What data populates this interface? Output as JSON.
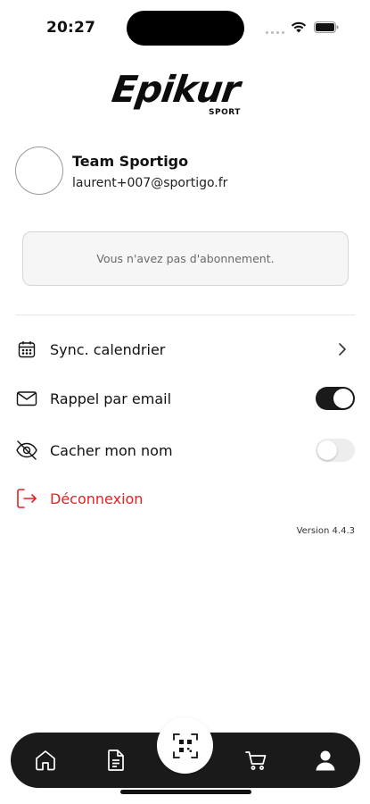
{
  "status_bar": {
    "time": "20:27"
  },
  "brand": {
    "logo_text": "Epikur",
    "logo_sub": "SPORT"
  },
  "profile": {
    "name": "Team Sportigo",
    "email": "laurent+007@sportigo.fr"
  },
  "subscription": {
    "message": "Vous n'avez pas d'abonnement."
  },
  "settings": {
    "calendar_sync": {
      "label": "Sync. calendrier",
      "icon": "calendar-icon"
    },
    "email_reminder": {
      "label": "Rappel par email",
      "icon": "mail-icon",
      "enabled": true
    },
    "hide_name": {
      "label": "Cacher mon nom",
      "icon": "eye-off-icon",
      "enabled": false
    },
    "logout": {
      "label": "Déconnexion",
      "icon": "logout-icon",
      "color": "#e02424"
    }
  },
  "version": "Version 4.4.3",
  "tabbar": {
    "items": [
      {
        "icon": "home-icon"
      },
      {
        "icon": "document-icon"
      },
      {
        "icon": "qr-scan-icon"
      },
      {
        "icon": "cart-icon"
      },
      {
        "icon": "profile-icon"
      }
    ]
  },
  "colors": {
    "accent_dark": "#1a1a1a",
    "danger": "#e02424"
  }
}
